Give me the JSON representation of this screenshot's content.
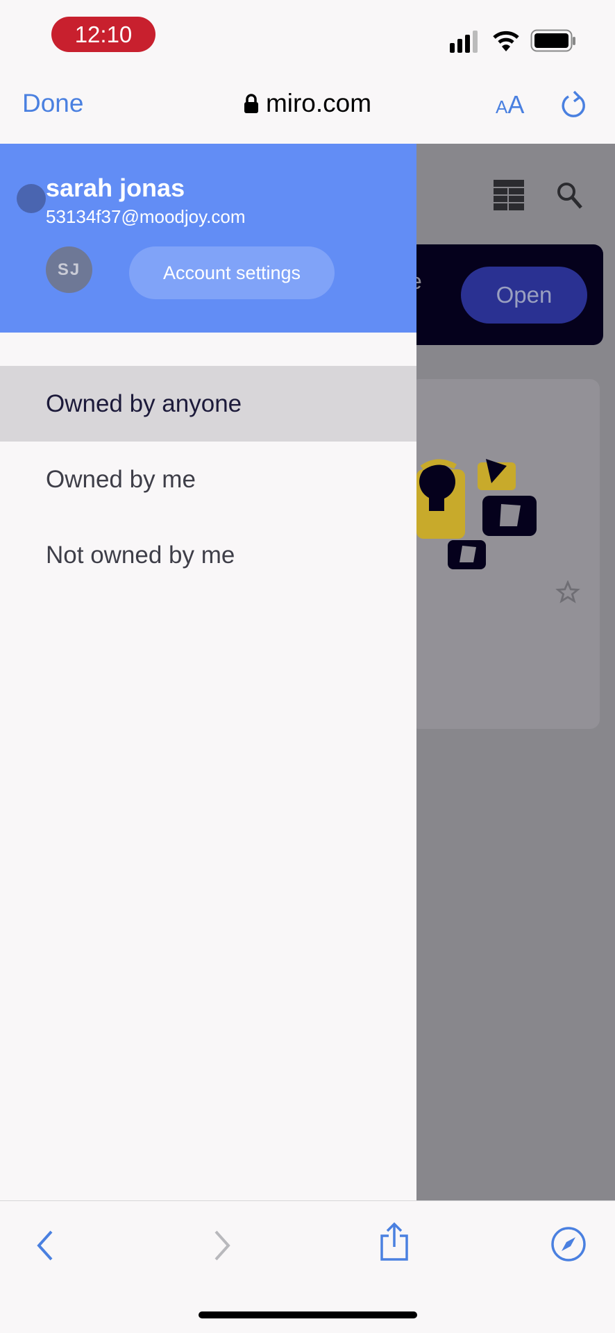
{
  "status": {
    "time": "12:10",
    "time_pill_color": "#c8202e"
  },
  "browser": {
    "done": "Done",
    "url": "miro.com",
    "text_size_small": "A",
    "text_size_large": "A"
  },
  "background": {
    "banner_text": "e",
    "open_button": "Open"
  },
  "drawer": {
    "user_name": "sarah jonas",
    "email": "53134f37@moodjoy.com",
    "avatar_initials": "SJ",
    "account_settings": "Account settings",
    "header_color": "#628df5",
    "items": [
      {
        "label": "Owned by anyone",
        "selected": true
      },
      {
        "label": "Owned by me",
        "selected": false
      },
      {
        "label": "Not owned by me",
        "selected": false
      }
    ]
  }
}
